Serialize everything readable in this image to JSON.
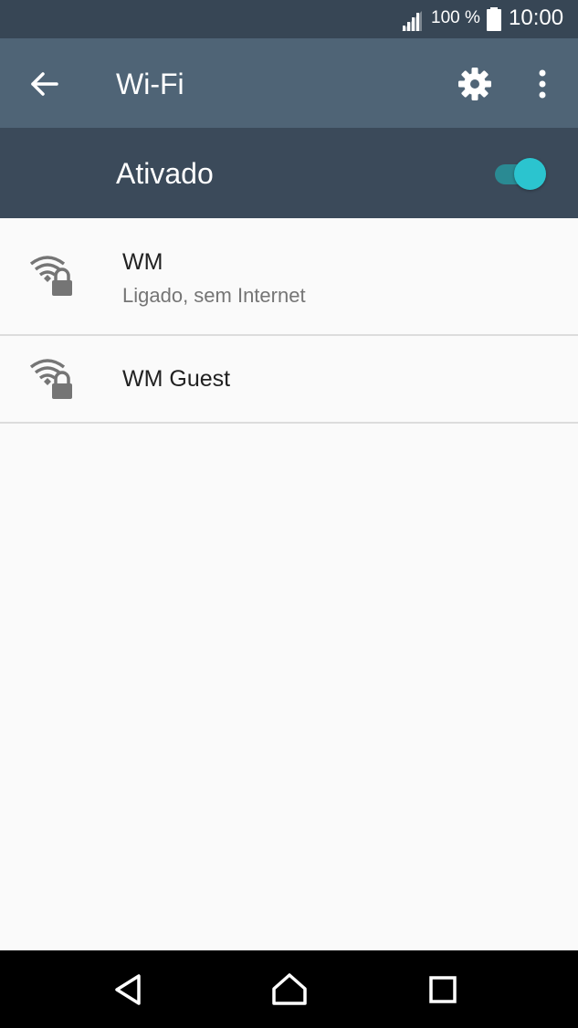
{
  "status_bar": {
    "battery_percent": "100 %",
    "time": "10:00",
    "signal_icon": "cellular-signal-icon",
    "battery_icon": "battery-full-icon"
  },
  "app_bar": {
    "title": "Wi-Fi",
    "back_icon": "arrow-back-icon",
    "settings_icon": "gear-icon",
    "more_icon": "more-vert-icon"
  },
  "wifi_toggle": {
    "label": "Ativado",
    "state": "on"
  },
  "networks": [
    {
      "name": "WM",
      "status": "Ligado, sem Internet",
      "icon": "wifi-locked-icon"
    },
    {
      "name": "WM Guest",
      "status": "",
      "icon": "wifi-locked-icon"
    }
  ],
  "colors": {
    "status_bar": "#374655",
    "app_bar": "#4f6476",
    "toggle_bar": "#3b4a5a",
    "accent": "#2bc4cf"
  },
  "nav_bar": {
    "back_icon": "nav-back-icon",
    "home_icon": "nav-home-icon",
    "recents_icon": "nav-recents-icon"
  }
}
